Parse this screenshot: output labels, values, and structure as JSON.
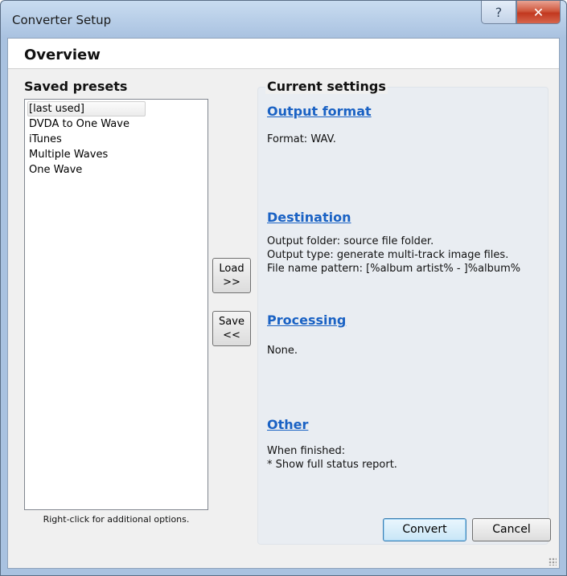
{
  "window": {
    "title": "Converter Setup",
    "help_glyph": "?",
    "close_glyph": "✕"
  },
  "header": {
    "title": "Overview"
  },
  "presets": {
    "title": "Saved presets",
    "items": [
      {
        "label": "[last used]"
      },
      {
        "label": "DVDA to One Wave"
      },
      {
        "label": "iTunes"
      },
      {
        "label": "Multiple Waves"
      },
      {
        "label": "One Wave"
      }
    ],
    "hint": "Right-click for additional options."
  },
  "actions": {
    "load_label": "Load",
    "load_arrow": ">>",
    "save_label": "Save",
    "save_arrow": "<<"
  },
  "settings": {
    "title": "Current settings",
    "sections": [
      {
        "heading": "Output format",
        "text": "Format: WAV."
      },
      {
        "heading": "Destination",
        "text": "Output folder: source file folder.\nOutput type: generate multi-track image files.\nFile name pattern: [%album artist% - ]%album%"
      },
      {
        "heading": "Processing",
        "text": "None."
      },
      {
        "heading": "Other",
        "text": "When finished:\n* Show full status report."
      }
    ]
  },
  "footer": {
    "convert_label": "Convert",
    "cancel_label": "Cancel"
  },
  "colors": {
    "link": "#1a62c4",
    "close_button": "#c2381f",
    "titlebar": "#b4cbe6"
  }
}
